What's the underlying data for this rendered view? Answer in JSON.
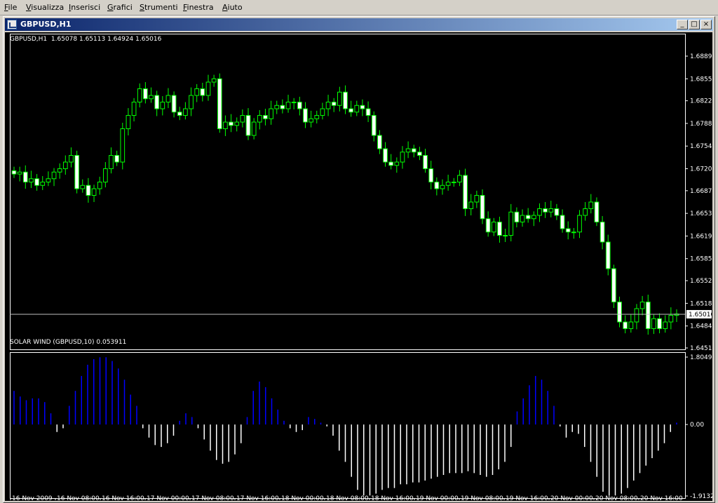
{
  "menu": [
    "File",
    "Visualizza",
    "Inserisci",
    "Grafici",
    "Strumenti",
    "Finestra",
    "Aiuto"
  ],
  "window": {
    "title": "GBPUSD,H1",
    "buttons": {
      "minimize": "_",
      "restore": "□",
      "close": "×"
    }
  },
  "chart_header": {
    "symbol": "GBPUSD,H1",
    "ohlc": "1.65078 1.65113 1.64924 1.65016"
  },
  "indicator_header": {
    "name": "SOLAR WIND (GBPUSD,10)",
    "value": "0.053911"
  },
  "colors": {
    "background": "#000000",
    "candle": "#00ff00",
    "bull_body": "#000000",
    "bear_body": "#ffffff",
    "indicator_positive": "#0000ff",
    "indicator_negative": "#ffffff",
    "bid_line": "#c0c0c0",
    "axis": "#ffffff"
  },
  "chart_data": [
    {
      "type": "candlestick",
      "symbol": "GBPUSD",
      "timeframe": "H1",
      "y_ticks": [
        "1.68890",
        "1.68550",
        "1.68220",
        "1.67880",
        "1.67540",
        "1.67200",
        "1.66870",
        "1.66530",
        "1.66190",
        "1.65850",
        "1.65520",
        "1.65180",
        "1.64840",
        "1.64510"
      ],
      "ylim": [
        1.6451,
        1.6889
      ],
      "current_price": "1.65016",
      "close": [
        1.6712,
        1.6715,
        1.67,
        1.6705,
        1.6695,
        1.67,
        1.6705,
        1.6715,
        1.672,
        1.673,
        1.674,
        1.669,
        1.6695,
        1.668,
        1.669,
        1.67,
        1.672,
        1.674,
        1.673,
        1.678,
        1.68,
        1.682,
        1.684,
        1.6825,
        1.683,
        1.681,
        1.682,
        1.683,
        1.6805,
        1.68,
        1.681,
        1.683,
        1.684,
        1.683,
        1.685,
        1.6855,
        1.678,
        1.679,
        1.6785,
        1.679,
        1.68,
        1.677,
        1.679,
        1.68,
        1.6795,
        1.681,
        1.6815,
        1.681,
        1.682,
        1.682,
        1.681,
        1.679,
        1.6795,
        1.68,
        1.681,
        1.682,
        1.6815,
        1.6835,
        1.681,
        1.6805,
        1.6815,
        1.681,
        1.68,
        1.677,
        1.675,
        1.673,
        1.6725,
        1.673,
        1.6745,
        1.675,
        1.6745,
        1.674,
        1.672,
        1.67,
        1.669,
        1.6695,
        1.67,
        1.67,
        1.671,
        1.666,
        1.667,
        1.668,
        1.6645,
        1.6625,
        1.664,
        1.662,
        1.662,
        1.6655,
        1.664,
        1.665,
        1.6645,
        1.665,
        1.666,
        1.6655,
        1.666,
        1.665,
        1.663,
        1.6625,
        1.6625,
        1.665,
        1.666,
        1.667,
        1.664,
        1.661,
        1.657,
        1.652,
        1.649,
        1.648,
        1.649,
        1.651,
        1.652,
        1.648,
        1.6495,
        1.648,
        1.649,
        1.65,
        1.6502
      ]
    },
    {
      "type": "histogram",
      "name": "SOLAR WIND",
      "y_ticks": [
        "1.804994",
        "0.00",
        "-1.913216"
      ],
      "ylim": [
        -1.913216,
        1.804994
      ],
      "values": [
        0.9,
        0.75,
        0.65,
        0.7,
        0.7,
        0.6,
        0.3,
        -0.2,
        -0.1,
        0.5,
        0.9,
        1.3,
        1.6,
        1.75,
        1.8,
        1.8,
        1.7,
        1.5,
        1.2,
        0.8,
        0.5,
        -0.1,
        -0.35,
        -0.55,
        -0.6,
        -0.5,
        -0.3,
        0.1,
        0.3,
        0.2,
        -0.1,
        -0.4,
        -0.7,
        -0.95,
        -1.05,
        -1.0,
        -0.8,
        -0.5,
        0.2,
        0.9,
        1.15,
        1.0,
        0.7,
        0.4,
        0.1,
        -0.1,
        -0.2,
        -0.15,
        0.2,
        0.15,
        0.05,
        -0.05,
        -0.3,
        -0.7,
        -1.0,
        -1.4,
        -1.75,
        -1.9,
        -1.9,
        -1.85,
        -1.75,
        -1.7,
        -1.7,
        -1.6,
        -1.6,
        -1.55,
        -1.55,
        -1.5,
        -1.45,
        -1.4,
        -1.35,
        -1.3,
        -1.3,
        -1.3,
        -1.25,
        -1.3,
        -1.35,
        -1.4,
        -1.35,
        -1.2,
        -1.0,
        -0.6,
        0.35,
        0.7,
        1.05,
        1.3,
        1.2,
        0.9,
        0.5,
        -0.05,
        -0.35,
        -0.2,
        -0.25,
        -0.6,
        -1.0,
        -1.4,
        -1.8,
        -1.9,
        -1.9,
        -1.85,
        -1.7,
        -1.5,
        -1.3,
        -1.1,
        -0.9,
        -0.7,
        -0.5,
        -0.2,
        0.05
      ]
    }
  ],
  "x_labels": [
    "16 Nov 2009",
    "16 Nov 08:00",
    "16 Nov 16:00",
    "17 Nov 00:00",
    "17 Nov 08:00",
    "17 Nov 16:00",
    "18 Nov 00:00",
    "18 Nov 08:00",
    "18 Nov 16:00",
    "19 Nov 00:00",
    "19 Nov 08:00",
    "19 Nov 16:00",
    "20 Nov 00:00",
    "20 Nov 08:00",
    "20 Nov 16:00"
  ]
}
